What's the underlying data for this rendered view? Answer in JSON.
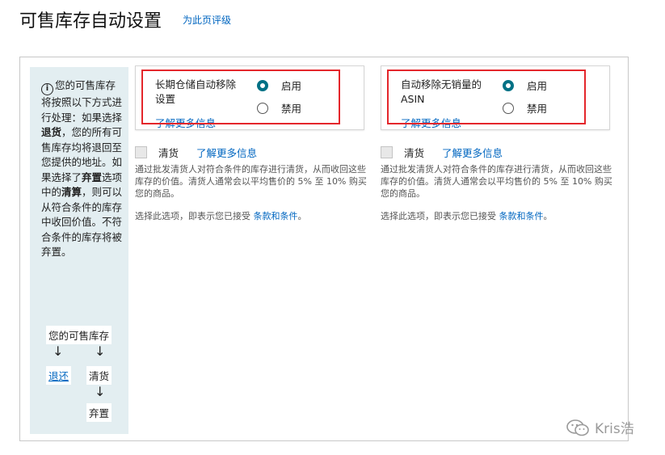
{
  "header": {
    "title": "可售库存自动设置",
    "rate_link": "为此页评级"
  },
  "sidebar": {
    "info_parts": [
      "您的可售库存将按照以下方式进行处理：如果选择",
      "退货",
      "，您的所有可售库存均将退回至您提供的地址。如果选择了",
      "弃置",
      "选项中的",
      "清算",
      "，则可以从符合条件的库存中收回价值。不符合条件的库存将被弃置。"
    ],
    "flow": {
      "root": "您的可售库存",
      "return": "退还",
      "liquidate": "清货",
      "dispose": "弃置"
    }
  },
  "cards": [
    {
      "title": "长期仓储自动移除设置",
      "enable": "启用",
      "disable": "禁用",
      "learn_more": "了解更多信息",
      "selected": "enable"
    },
    {
      "title": "自动移除无销量的 ASIN",
      "enable": "启用",
      "disable": "禁用",
      "learn_more": "了解更多信息",
      "selected": "enable"
    }
  ],
  "clearance": [
    {
      "label": "清货",
      "learn_more": "了解更多信息",
      "desc": "通过批发清货人对符合条件的库存进行清货，从而收回这些库存的价值。清货人通常会以平均售价的 5% 至 10% 购买您的商品。",
      "terms_prefix": "选择此选项，即表示您已接受",
      "terms_link": "条款和条件",
      "terms_suffix": "。"
    },
    {
      "label": "清货",
      "learn_more": "了解更多信息",
      "desc": "通过批发清货人对符合条件的库存进行清货，从而收回这些库存的价值。清货人通常会以平均售价的 5% 至 10% 购买您的商品。",
      "terms_prefix": "选择此选项，即表示您已接受",
      "terms_link": "条款和条件",
      "terms_suffix": "。"
    }
  ],
  "watermark": {
    "text": "Kris浩"
  },
  "colors": {
    "link": "#0066c0",
    "radio_checked": "#007185",
    "highlight": "#e4262b",
    "sidebar_bg": "#e3eef1"
  }
}
